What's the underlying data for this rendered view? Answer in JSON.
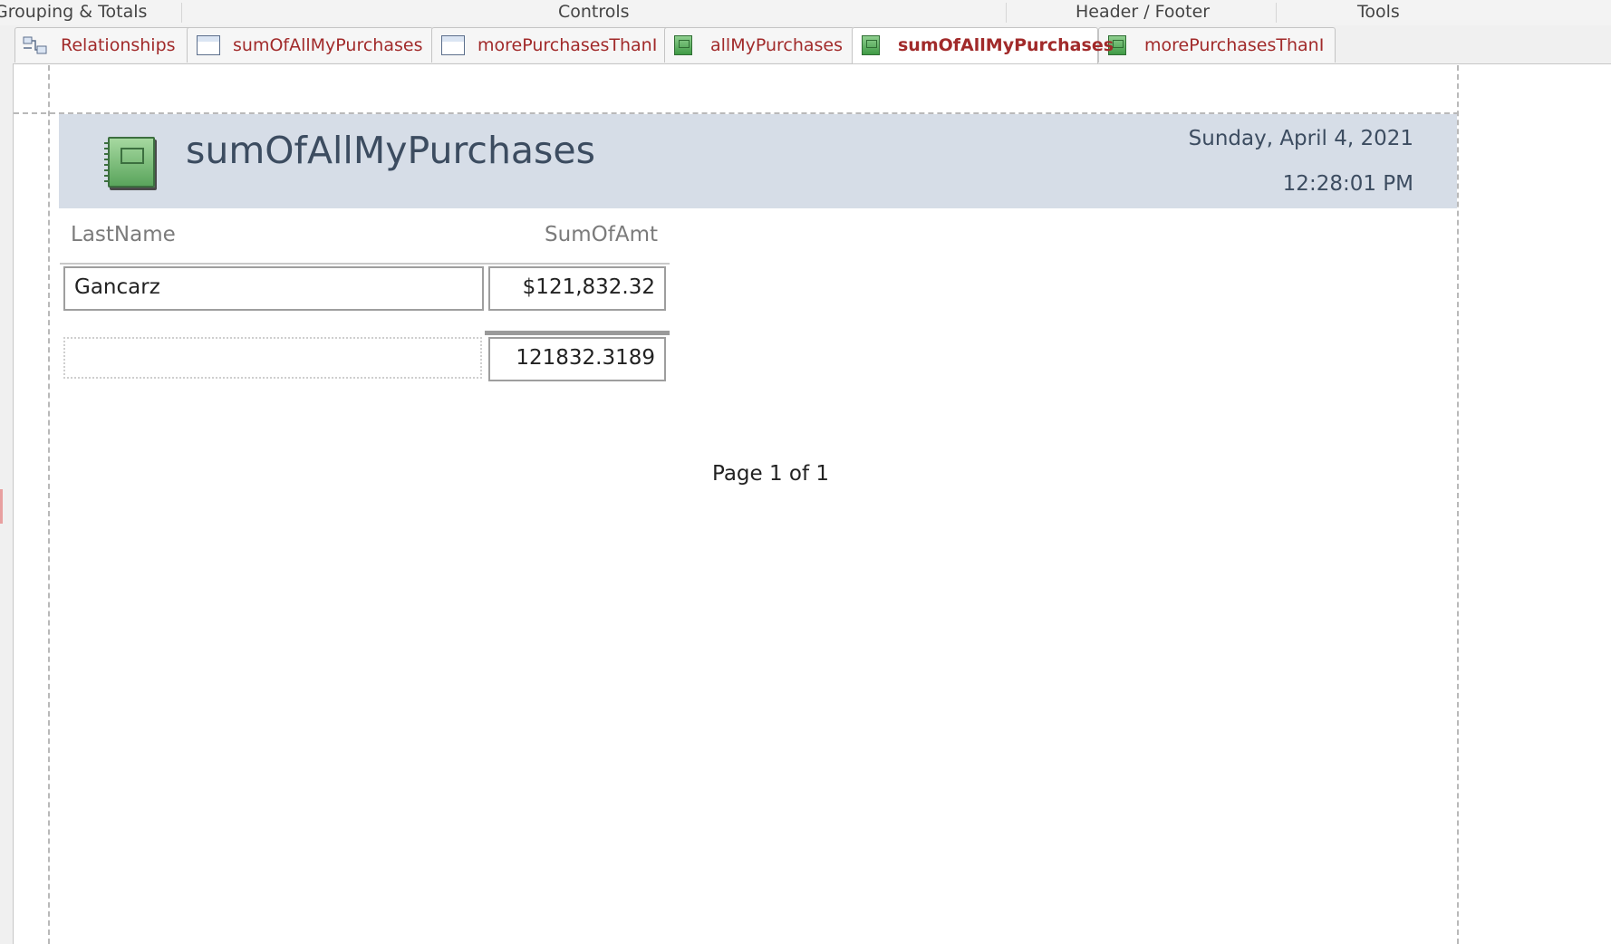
{
  "ribbon": {
    "groups": [
      "Grouping & Totals",
      "Controls",
      "Header / Footer",
      "Tools"
    ]
  },
  "tabs": [
    {
      "label": "Relationships",
      "icon": "relationships-icon",
      "active": false
    },
    {
      "label": "sumOfAllMyPurchases",
      "icon": "query-icon",
      "active": false
    },
    {
      "label": "morePurchasesThanI",
      "icon": "query-icon",
      "active": false
    },
    {
      "label": "allMyPurchases",
      "icon": "report-icon",
      "active": false
    },
    {
      "label": "sumOfAllMyPurchases",
      "icon": "report-icon",
      "active": true
    },
    {
      "label": "morePurchasesThanI",
      "icon": "report-icon",
      "active": false
    }
  ],
  "report": {
    "title": "sumOfAllMyPurchases",
    "date": "Sunday, April 4, 2021",
    "time": "12:28:01 PM",
    "columns": [
      "LastName",
      "SumOfAmt"
    ],
    "row": {
      "LastName": "Gancarz",
      "SumOfAmt": "$121,832.32"
    },
    "total": "121832.3189",
    "page_number": "Page 1 of 1"
  },
  "colors": {
    "tab_text": "#a12a2a",
    "header_band": "#d6dde7",
    "title_text": "#3c4c60"
  }
}
